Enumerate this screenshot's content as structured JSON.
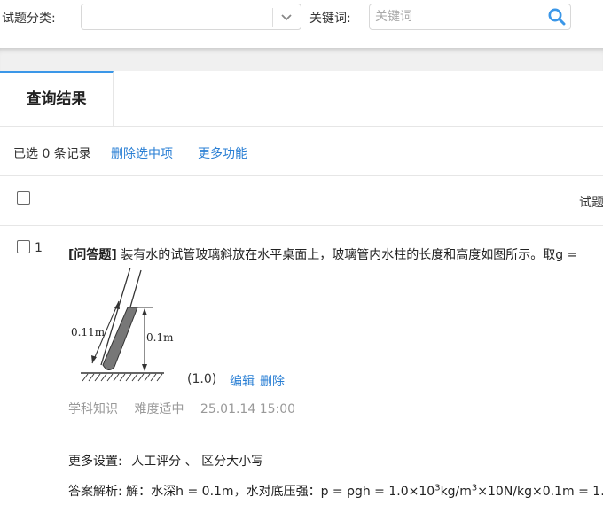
{
  "filters": {
    "category_label": "试题分类:",
    "category_value": "",
    "keyword_label": "关键词:",
    "keyword_placeholder": "关键词"
  },
  "tab": {
    "label": "查询结果"
  },
  "toolbar": {
    "selected_text": "已选 0 条记录",
    "delete_selected": "删除选中项",
    "more_functions": "更多功能"
  },
  "table": {
    "column_header": "试题"
  },
  "question": {
    "index": "1",
    "type_tag": "[问答题]",
    "text": "装有水的试管玻璃斜放在水平桌面上，玻璃管内水柱的长度和高度如图所示。取g =",
    "figure": {
      "label_length": "0.11m",
      "label_height": "0.1m"
    },
    "score": "(1.0)",
    "edit_label": "编辑",
    "delete_label": "删除",
    "meta": {
      "category": "学科知识",
      "difficulty": "难度适中",
      "date": "25.01.14 15:00"
    },
    "more_settings_label": "更多设置:",
    "more_settings_value": "人工评分 、 区分大小写",
    "analysis_prefix": "答案解析: 解：水深h = 0.1m，水对底压强：p = ρgh = 1.0×10",
    "analysis_exp1": "3",
    "analysis_mid": "kg/m",
    "analysis_exp2": "3",
    "analysis_suffix": "×10N/kg×0.1m = 1."
  },
  "colors": {
    "accent": "#3b97e8",
    "link": "#2a7fd4",
    "muted": "#999999"
  }
}
